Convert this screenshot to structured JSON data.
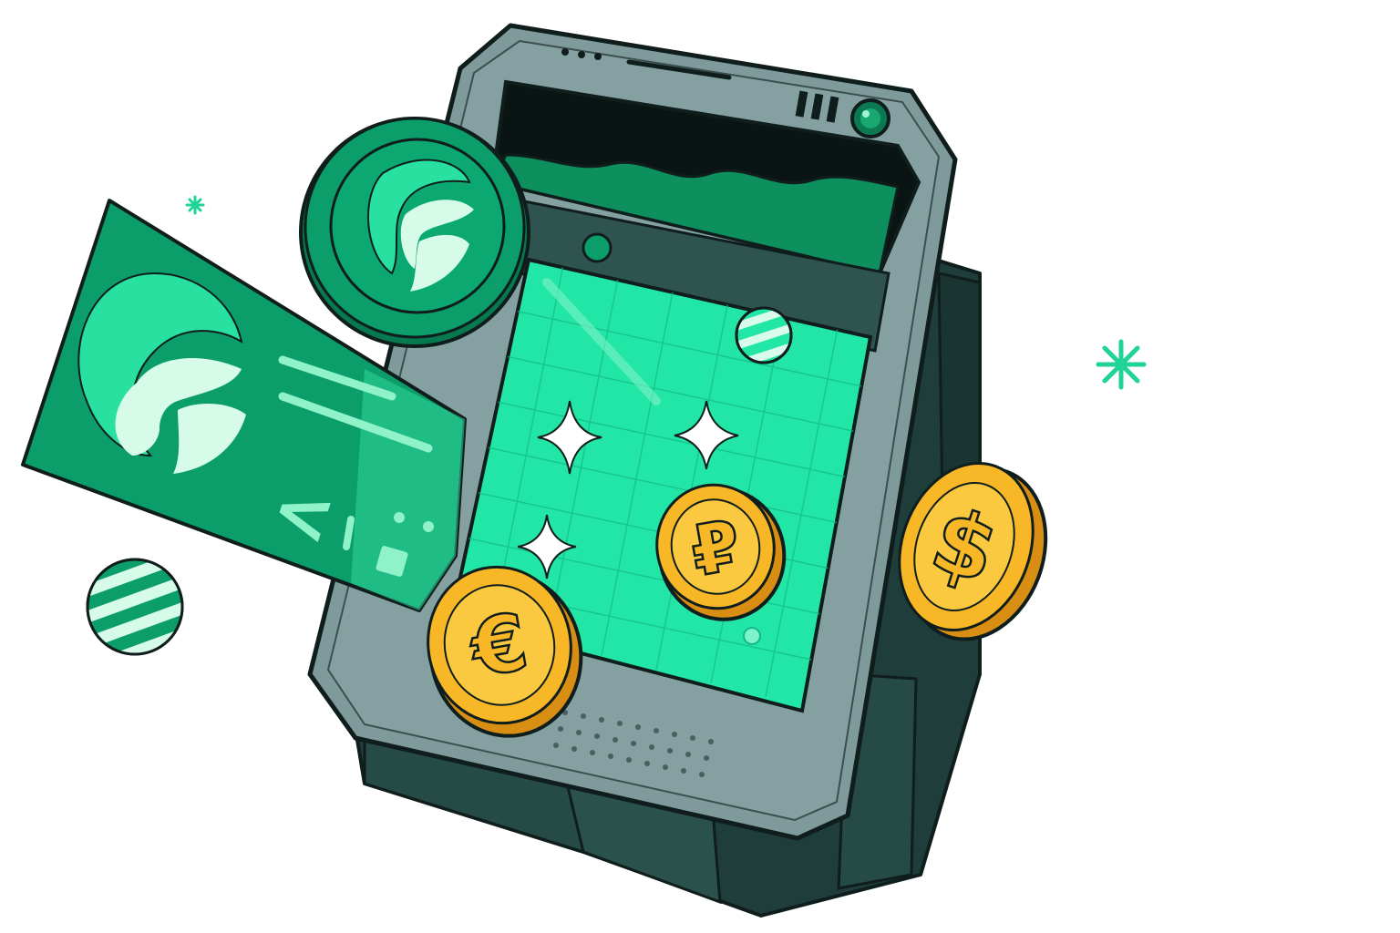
{
  "scene": {
    "description_role": "illustration",
    "colors": {
      "brand_green": "#0b9e6a",
      "brand_green_dark": "#07794f",
      "mint": "#28e0a0",
      "mint_light": "#8ff2c9",
      "screen_green": "#22e6a5",
      "device_frame": "#7f9a9a",
      "device_body": "#1f3d3a",
      "coin_gold": "#f7b726",
      "coin_gold_dark": "#d88e12",
      "outline": "#0f1e1c"
    }
  },
  "coins": {
    "ruble_symbol": "₽",
    "euro_symbol": "€",
    "dollar_symbol": "$"
  },
  "card": {
    "code_symbol": "<",
    "logo_letter": "F"
  },
  "icons": [
    "brand-logo-coin-icon",
    "brand-card-icon",
    "ruble-coin-icon",
    "euro-coin-icon",
    "dollar-coin-icon",
    "sparkle-icon",
    "striped-ball-icon",
    "asterisk-icon",
    "indicator-light-icon"
  ]
}
